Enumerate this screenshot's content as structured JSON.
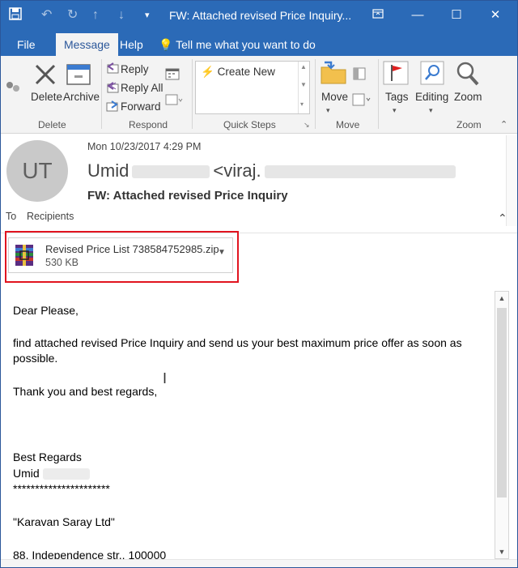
{
  "window": {
    "title": "FW: Attached revised Price Inquiry...",
    "quick_access": [
      "save-icon",
      "undo-icon",
      "redo-icon",
      "up-arrow-icon",
      "down-arrow-icon",
      "more-icon"
    ],
    "controls": [
      "restore-icon",
      "minimize-icon",
      "maximize-icon",
      "close-icon"
    ]
  },
  "tabs": [
    {
      "label": "File"
    },
    {
      "label": "Message"
    },
    {
      "label": "Help"
    }
  ],
  "tellme": "Tell me what you want to do",
  "ribbon": {
    "delete_label": "Delete",
    "archive_label": "Archive",
    "group_delete": "Delete",
    "reply": "Reply",
    "reply_all": "Reply All",
    "forward": "Forward",
    "group_respond": "Respond",
    "create_new": "Create New",
    "group_quick_steps": "Quick Steps",
    "move": "Move",
    "group_move": "Move",
    "tags": "Tags",
    "editing": "Editing",
    "zoom": "Zoom",
    "group_zoom": "Zoom"
  },
  "header": {
    "avatar_initials": "UT",
    "datetime": "Mon 10/23/2017 4:29 PM",
    "sender_first": "Umid",
    "sender_email_start": "<viraj.",
    "subject": "FW: Attached revised Price Inquiry",
    "to_label": "To",
    "recipients": "Recipients"
  },
  "attachment": {
    "name": "Revised Price List 738584752985.zip",
    "size": "530 KB"
  },
  "body": {
    "line1": "Dear Please,",
    "line2": "find attached revised Price Inquiry and send us your best maximum price offer as soon as",
    "line3": "possible.",
    "line4": "Thank you and best regards,",
    "line5": "Best Regards",
    "line6": "Umid",
    "line7": "**********************",
    "line8": "\"Karavan Saray Ltd\"",
    "line9": "88, Independence str., 100000"
  },
  "colors": {
    "accent": "#2b6ab7",
    "highlight_box": "#e1141f"
  }
}
